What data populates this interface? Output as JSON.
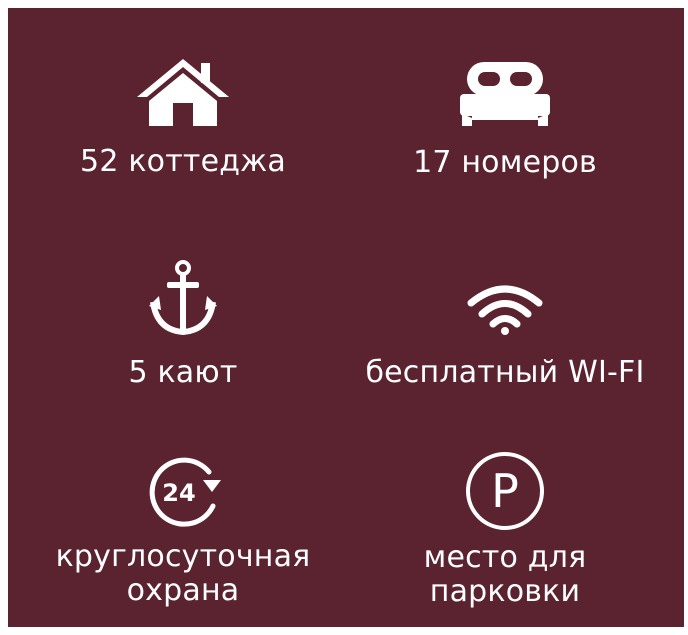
{
  "colors": {
    "background": "#5b2330",
    "foreground": "#ffffff"
  },
  "features": [
    {
      "icon": "house-icon",
      "label": "52 коттеджа"
    },
    {
      "icon": "bed-icon",
      "label": "17 номеров"
    },
    {
      "icon": "anchor-icon",
      "label": "5 кают"
    },
    {
      "icon": "wifi-icon",
      "label": "бесплатный WI-FI"
    },
    {
      "icon": "clock-24-icon",
      "icon_text": "24",
      "label_line1": "круглосуточная",
      "label_line2": "охрана"
    },
    {
      "icon": "parking-icon",
      "icon_text": "P",
      "label_line1": "место для",
      "label_line2": "парковки"
    }
  ]
}
